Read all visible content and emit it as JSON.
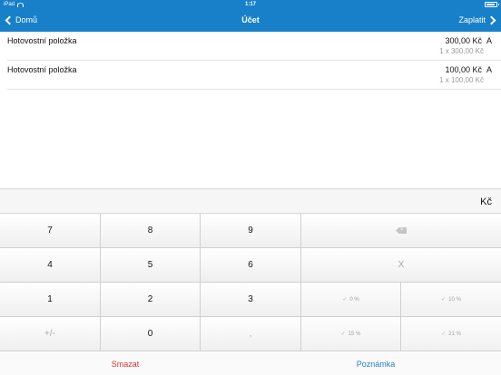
{
  "status": {
    "carrier": "iPad",
    "time": "1:17"
  },
  "nav": {
    "back_label": "Domů",
    "title": "Účet",
    "pay_label": "Zaplatit"
  },
  "items": [
    {
      "name": "Hotovostní položka",
      "amount": "300,00 Kč",
      "tax": "A",
      "qty": "1 x 300,00 Kč"
    },
    {
      "name": "Hotovostní položka",
      "amount": "100,00 Kč",
      "tax": "A",
      "qty": "1 x 100,00 Kč"
    }
  ],
  "display": {
    "currency": "Kč"
  },
  "keypad": {
    "k7": "7",
    "k8": "8",
    "k9": "9",
    "k4": "4",
    "k5": "5",
    "k6": "6",
    "k1": "1",
    "k2": "2",
    "k3": "3",
    "sign": "+/-",
    "k0": "0",
    "decimal": ",",
    "clear": "X",
    "vat0": "0 %",
    "vat10": "10 %",
    "vat15": "15 %",
    "vat21": "21 %"
  },
  "bottom": {
    "delete_label": "Smazat",
    "note_label": "Poznámka"
  },
  "colors": {
    "accent": "#1880c8",
    "delete": "#d9352b",
    "note": "#1f82c8"
  }
}
